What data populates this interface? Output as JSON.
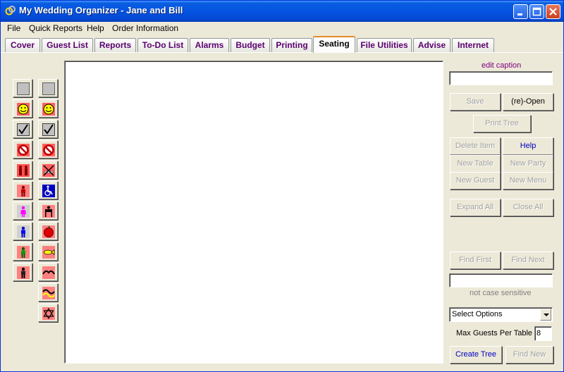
{
  "window": {
    "title": "My Wedding Organizer - Jane and Bill"
  },
  "menu": [
    "File",
    "Quick Reports",
    "Help",
    "Order Information"
  ],
  "tabs": [
    "Cover",
    "Guest List",
    "Reports",
    "To-Do List",
    "Alarms",
    "Budget",
    "Printing",
    "Seating",
    "File Utilities",
    "Advise",
    "Internet"
  ],
  "active_tab": "Seating",
  "palette": {
    "column1": [
      "blank-icon",
      "smiley-icon",
      "checkmark-icon",
      "no-sign-icon",
      "couple-icon",
      "man-red-icon",
      "woman-pink-icon",
      "man-blue-icon",
      "man-green-icon",
      "man-black-icon"
    ],
    "column2": [
      "blank-icon",
      "smiley-icon",
      "checkmark-icon",
      "no-sign-icon",
      "no-smoking-icon",
      "wheelchair-icon",
      "highchair-icon",
      "apple-icon",
      "fish-icon",
      "mustache-icon",
      "wave-icon",
      "star-of-david-icon"
    ]
  },
  "panel": {
    "edit_caption_label": "edit caption",
    "caption_value": "",
    "save": "Save",
    "reopen": "(re)-Open",
    "print_tree": "Print Tree",
    "delete_item": "Delete Item",
    "help": "Help",
    "new_table": "New Table",
    "new_party": "New Party",
    "new_guest": "New Guest",
    "new_menu": "New Menu",
    "expand_all": "Expand All",
    "close_all": "Close All",
    "find_first": "Find First",
    "find_next": "Find Next",
    "find_value": "",
    "not_case_sensitive": "not case sensitive",
    "select_options": "Select Options",
    "max_guests_label": "Max Guests Per Table",
    "max_guests_value": "8",
    "create_tree": "Create Tree",
    "find_new": "Find New"
  },
  "colors": {
    "tab_text": "#5a0070",
    "active_tab_accent": "#e68b2c",
    "link_blue": "#0000c0",
    "caption_label": "#800080"
  }
}
